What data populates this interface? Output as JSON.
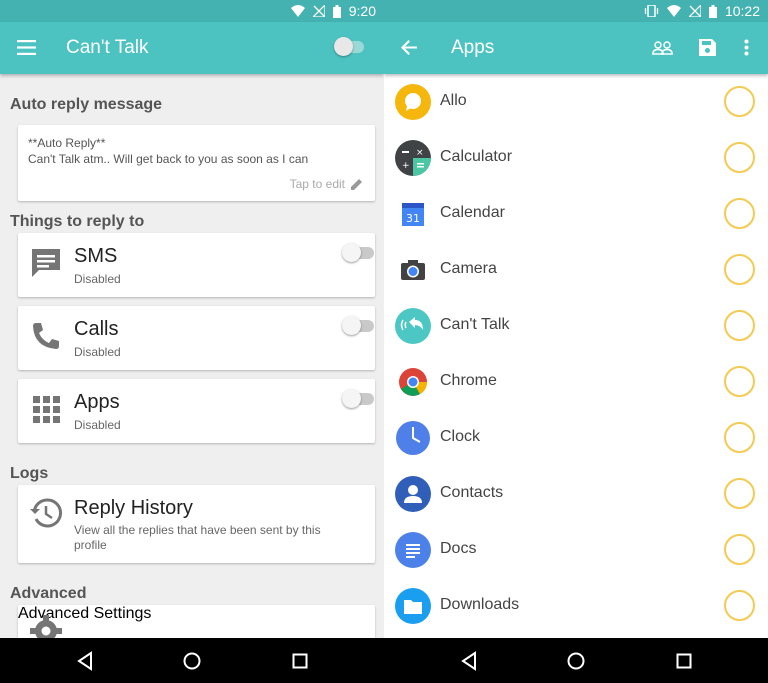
{
  "left": {
    "status_time": "9:20",
    "title": "Can't Talk",
    "auto_reply_header": "Auto reply message",
    "message_line1": "**Auto Reply**",
    "message_line2": "Can't Talk atm.. Will get back to you as soon as I can",
    "tap_to_edit": "Tap to edit",
    "things_header": "Things to reply to",
    "options": [
      {
        "title": "SMS",
        "status": "Disabled"
      },
      {
        "title": "Calls",
        "status": "Disabled"
      },
      {
        "title": "Apps",
        "status": "Disabled"
      }
    ],
    "logs_header": "Logs",
    "reply_history_title": "Reply History",
    "reply_history_desc": "View all the replies that have been sent by this profile",
    "advanced_header": "Advanced",
    "advanced_settings_title": "Advanced Settings"
  },
  "right": {
    "status_time": "10:22",
    "title": "Apps",
    "apps": [
      {
        "label": "Allo",
        "icon": "allo-icon"
      },
      {
        "label": "Calculator",
        "icon": "calculator-icon"
      },
      {
        "label": "Calendar",
        "icon": "calendar-icon"
      },
      {
        "label": "Camera",
        "icon": "camera-icon"
      },
      {
        "label": "Can't Talk",
        "icon": "cant-talk-icon"
      },
      {
        "label": "Chrome",
        "icon": "chrome-icon"
      },
      {
        "label": "Clock",
        "icon": "clock-icon"
      },
      {
        "label": "Contacts",
        "icon": "contacts-icon"
      },
      {
        "label": "Docs",
        "icon": "docs-icon"
      },
      {
        "label": "Downloads",
        "icon": "downloads-icon"
      }
    ],
    "calendar_day": "31"
  },
  "colors": {
    "primary": "#4cc3c1",
    "status_bar": "#44b2b0",
    "check_ring": "#f2cb53"
  }
}
